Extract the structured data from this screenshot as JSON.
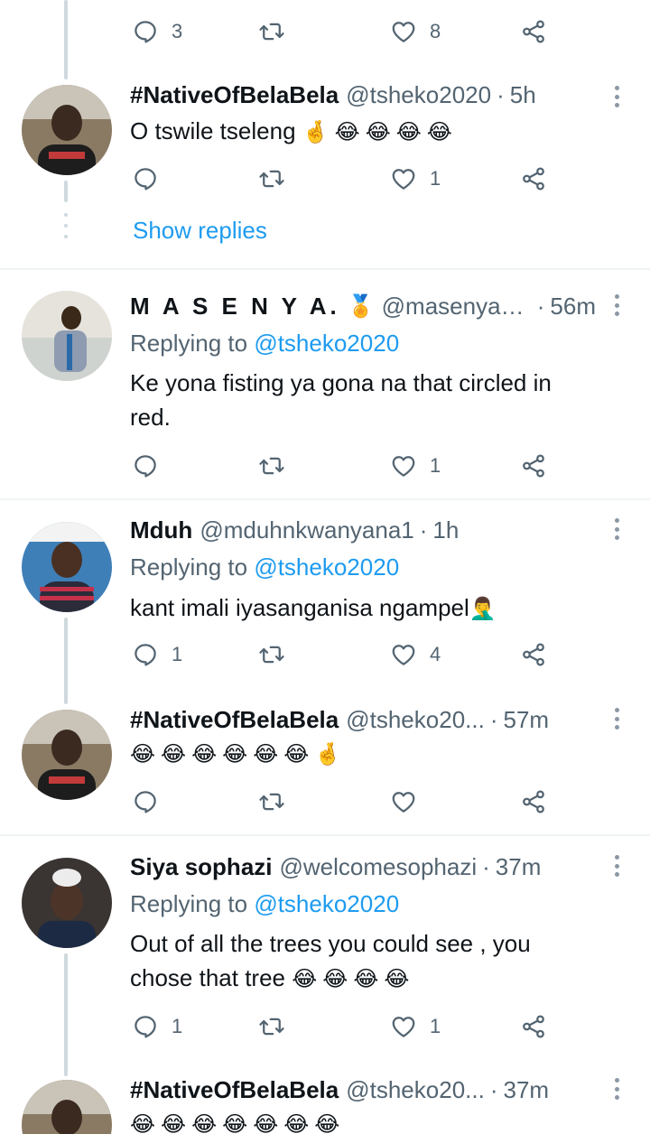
{
  "top_actions": {
    "reply_count": "3",
    "retweet_count": "",
    "like_count": "8"
  },
  "show_replies_label": "Show replies",
  "tweets": [
    {
      "name": "#NativeOfBelaBela",
      "handle": "@tsheko2020",
      "time": "5h",
      "replying_prefix": "",
      "replying_to": "",
      "text": "O tswile tseleng",
      "emojis": [
        "🤞",
        "😂",
        "😂",
        "😂",
        "😂"
      ],
      "reply_count": "",
      "retweet_count": "",
      "like_count": "1"
    },
    {
      "name": "M A S E N Y A.",
      "badge": "🏅",
      "handle": "@masenyam...",
      "time": "56m",
      "replying_prefix": "Replying to",
      "replying_to": "@tsheko2020",
      "text_line1": "Ke yona fisting ya gona na that circled in",
      "text_line2": "red.",
      "reply_count": "",
      "retweet_count": "",
      "like_count": "1"
    },
    {
      "name": "Mduh",
      "handle": "@mduhnkwanyana1",
      "time": "1h",
      "replying_prefix": "Replying to",
      "replying_to": "@tsheko2020",
      "text": "kant imali iyasanganisa ngampel",
      "emojis": [
        "🤦‍♂️"
      ],
      "reply_count": "1",
      "retweet_count": "",
      "like_count": "4"
    },
    {
      "name": "#NativeOfBelaBela",
      "handle": "@tsheko20...",
      "time": "57m",
      "emojis": [
        "😂",
        "😂",
        "😂",
        "😂",
        "😂",
        "😂",
        "🤞"
      ],
      "reply_count": "",
      "retweet_count": "",
      "like_count": ""
    },
    {
      "name": "Siya sophazi",
      "handle": "@welcomesophazi",
      "time": "37m",
      "replying_prefix": "Replying to",
      "replying_to": "@tsheko2020",
      "text_line1": "Out of all the trees you could see , you",
      "text_line2": "chose that tree",
      "emojis": [
        "😂",
        "😂",
        "😂",
        "😂"
      ],
      "reply_count": "1",
      "retweet_count": "",
      "like_count": "1"
    },
    {
      "name": "#NativeOfBelaBela",
      "handle": "@tsheko20...",
      "time": "37m",
      "emojis": [
        "😂",
        "😂",
        "😂",
        "😂",
        "😂",
        "😂",
        "😂"
      ]
    }
  ],
  "colors": {
    "accent": "#1d9bf0",
    "muted": "#536471",
    "text": "#0f1419",
    "divider": "#eff3f4",
    "thread": "#cfd9de"
  },
  "icons": [
    "reply-icon",
    "retweet-icon",
    "like-icon",
    "share-icon",
    "more-icon"
  ]
}
